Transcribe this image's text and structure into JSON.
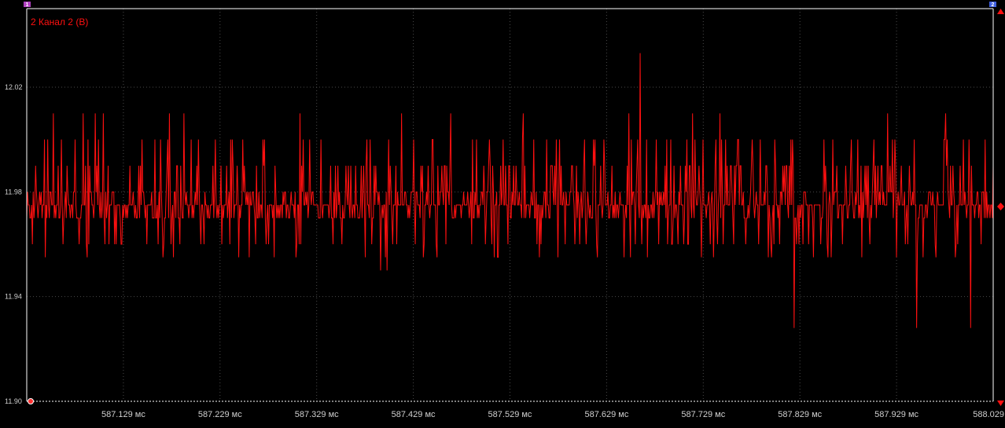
{
  "channel": {
    "label": "2 Канал 2 (В)",
    "color": "#ff1010"
  },
  "markers": {
    "left": "1",
    "right": "2",
    "left_color": "#b040c0",
    "right_color": "#4060e0"
  },
  "colors": {
    "background": "#000000",
    "grid": "#4a4a4a",
    "frame": "#ffffff",
    "tick_text": "#cfcfcf",
    "trace": "#ff1010"
  },
  "chart_data": {
    "type": "line",
    "title": "",
    "xlabel": "",
    "ylabel": "2 Канал 2 (В)",
    "x_unit": "мс",
    "xlim": [
      587.029,
      588.029
    ],
    "ylim": [
      11.9,
      12.05
    ],
    "grid": true,
    "y_ticks": [
      {
        "value": 12.02,
        "label": "12.02"
      },
      {
        "value": 11.98,
        "label": "11.98"
      },
      {
        "value": 11.94,
        "label": "11.94"
      },
      {
        "value": 11.9,
        "label": "11.90"
      }
    ],
    "x_ticks": [
      {
        "value": 587.129,
        "label": "587.129 мс"
      },
      {
        "value": 587.229,
        "label": "587.229 мс"
      },
      {
        "value": 587.329,
        "label": "587.329 мс"
      },
      {
        "value": 587.429,
        "label": "587.429 мс"
      },
      {
        "value": 587.529,
        "label": "587.529 мс"
      },
      {
        "value": 587.629,
        "label": "587.629 мс"
      },
      {
        "value": 587.729,
        "label": "587.729 мс"
      },
      {
        "value": 587.829,
        "label": "587.829 мс"
      },
      {
        "value": 587.929,
        "label": "587.929 мс"
      },
      {
        "value": 588.029,
        "label": "588.029"
      }
    ],
    "series": [
      {
        "values": [
          11.97,
          11.97,
          12.0,
          11.99,
          11.96,
          11.98,
          11.97,
          11.99,
          11.95,
          11.97,
          11.97,
          11.99,
          11.97,
          11.97,
          11.96,
          11.97,
          11.98,
          11.97,
          11.99,
          11.97,
          11.98,
          11.96,
          12.01,
          11.97,
          11.97,
          11.99,
          11.98,
          11.96,
          11.97,
          11.98,
          11.99,
          11.97,
          11.98,
          11.96,
          11.97,
          11.97,
          11.98,
          11.97,
          11.99,
          11.97,
          12.0,
          11.97,
          11.96,
          11.98,
          11.97,
          11.99,
          11.98,
          11.97,
          11.97,
          11.96,
          11.97,
          11.98,
          11.97,
          11.99,
          11.97,
          12.01,
          11.97,
          11.96,
          11.97,
          11.99,
          11.98,
          11.97,
          11.99,
          11.97,
          11.97,
          12.0,
          11.96,
          11.97,
          11.98,
          11.97,
          12.01,
          11.99,
          11.97,
          11.96,
          11.97,
          11.98,
          11.97,
          11.99,
          11.97,
          11.97,
          11.98,
          11.96,
          12.0,
          11.97,
          11.97,
          11.99,
          11.96,
          11.97,
          11.98,
          11.97,
          11.99,
          11.97,
          11.96,
          11.97,
          11.98,
          11.97,
          12.0,
          11.97,
          11.99,
          11.97,
          11.98,
          11.97,
          11.99,
          11.97,
          11.96,
          11.97,
          11.98,
          11.99,
          11.97,
          11.97,
          11.99,
          11.95,
          11.97,
          11.98,
          11.97,
          11.99,
          11.97,
          11.99,
          11.97,
          11.97,
          11.98,
          11.95,
          11.97,
          11.97,
          11.99,
          11.97,
          11.98,
          11.96,
          11.99,
          11.97,
          11.97,
          12.0,
          11.97,
          11.96,
          11.98,
          11.97,
          11.99,
          11.97,
          11.98,
          11.97,
          11.99,
          11.97,
          11.97,
          11.98,
          11.96,
          11.97,
          11.99,
          11.97,
          11.98,
          11.97,
          12.0,
          11.97,
          11.96,
          11.97,
          11.98,
          11.97,
          11.99,
          11.97,
          11.97,
          11.98,
          11.96,
          11.97,
          11.99,
          11.97,
          11.97,
          11.99,
          11.98,
          11.96,
          11.97,
          11.99,
          11.97,
          11.97,
          11.96,
          11.97,
          11.99,
          11.98,
          11.97,
          11.99,
          11.97,
          11.97,
          11.98,
          11.96,
          11.97,
          11.99,
          11.97,
          11.98,
          11.96,
          11.97,
          11.99,
          11.97,
          11.97,
          11.98,
          11.97,
          11.99,
          11.97,
          11.96,
          11.97,
          12.0,
          11.97,
          11.98,
          11.97,
          11.96,
          11.97,
          11.99,
          11.98,
          11.97,
          11.99,
          11.97,
          11.96,
          11.97,
          11.98,
          11.99,
          11.97,
          11.97,
          11.99,
          11.97,
          11.98,
          11.96,
          11.97,
          11.99,
          11.97,
          11.99,
          11.98,
          11.97,
          11.97,
          11.96,
          11.97,
          11.99,
          11.98,
          11.97,
          11.97,
          11.99,
          11.96,
          11.97,
          11.98,
          11.97,
          11.99,
          11.97,
          11.96,
          11.97,
          11.98,
          11.97,
          11.99,
          11.97,
          11.96,
          11.97,
          11.98,
          11.97,
          11.99,
          11.97,
          11.97,
          11.97,
          11.99,
          11.98,
          11.97,
          11.97,
          11.96,
          11.97,
          11.99,
          11.97,
          11.98,
          11.97,
          11.97,
          11.99,
          11.96,
          11.97,
          11.98,
          11.97,
          11.97,
          11.99,
          11.97,
          11.96,
          11.97,
          11.98,
          11.97,
          11.97,
          11.99,
          11.97,
          11.97,
          11.98,
          11.96,
          11.97,
          11.99,
          11.97,
          11.97,
          11.98,
          11.97,
          11.99,
          11.97,
          11.96,
          11.97,
          11.98,
          11.97,
          11.99,
          11.97,
          11.97,
          11.97,
          11.99,
          11.97,
          11.98,
          11.96,
          11.97,
          11.99,
          11.97,
          11.97,
          11.98,
          11.97,
          11.99,
          11.96,
          11.97,
          11.97,
          11.99,
          11.98,
          11.97,
          11.97,
          11.96,
          11.97,
          11.99,
          11.97,
          11.98,
          11.97,
          11.97,
          11.99,
          11.96,
          11.97,
          11.98,
          11.97,
          11.97,
          11.99,
          11.97,
          11.98,
          11.96,
          11.97,
          11.99,
          11.97,
          11.97,
          11.98,
          11.97,
          11.99,
          11.97,
          11.96,
          11.97,
          11.98,
          11.97,
          11.99,
          11.97,
          11.97,
          11.98,
          11.96,
          11.97,
          11.99,
          11.97,
          11.97,
          11.98,
          11.97,
          11.99,
          11.97,
          11.96,
          11.97,
          11.98,
          11.99,
          11.97,
          11.97,
          11.96,
          11.97,
          11.99,
          11.98,
          11.97,
          11.97,
          11.99,
          11.96,
          11.97,
          11.98,
          11.97,
          11.99,
          11.97,
          11.97,
          11.96,
          11.97,
          11.98,
          11.97,
          11.99,
          11.97,
          11.97,
          11.98,
          11.96,
          11.97,
          11.99,
          11.97,
          11.97,
          11.98,
          11.97,
          11.99,
          11.97,
          11.96,
          11.97,
          11.98,
          11.97,
          11.99,
          11.97,
          11.97,
          11.98,
          11.96,
          11.97,
          11.99,
          11.97,
          11.97,
          11.98,
          11.97,
          11.99,
          11.97,
          11.96,
          11.97,
          11.98,
          11.97,
          11.99,
          11.97,
          11.97,
          11.98,
          11.96,
          11.97,
          11.99,
          11.97
        ],
        "note_peaks": "visible spikes at approx 587.664 ms (12.03), 587.823 ms (11.93), 587.950 ms (11.93), 588.006 ms (11.93)"
      }
    ]
  }
}
